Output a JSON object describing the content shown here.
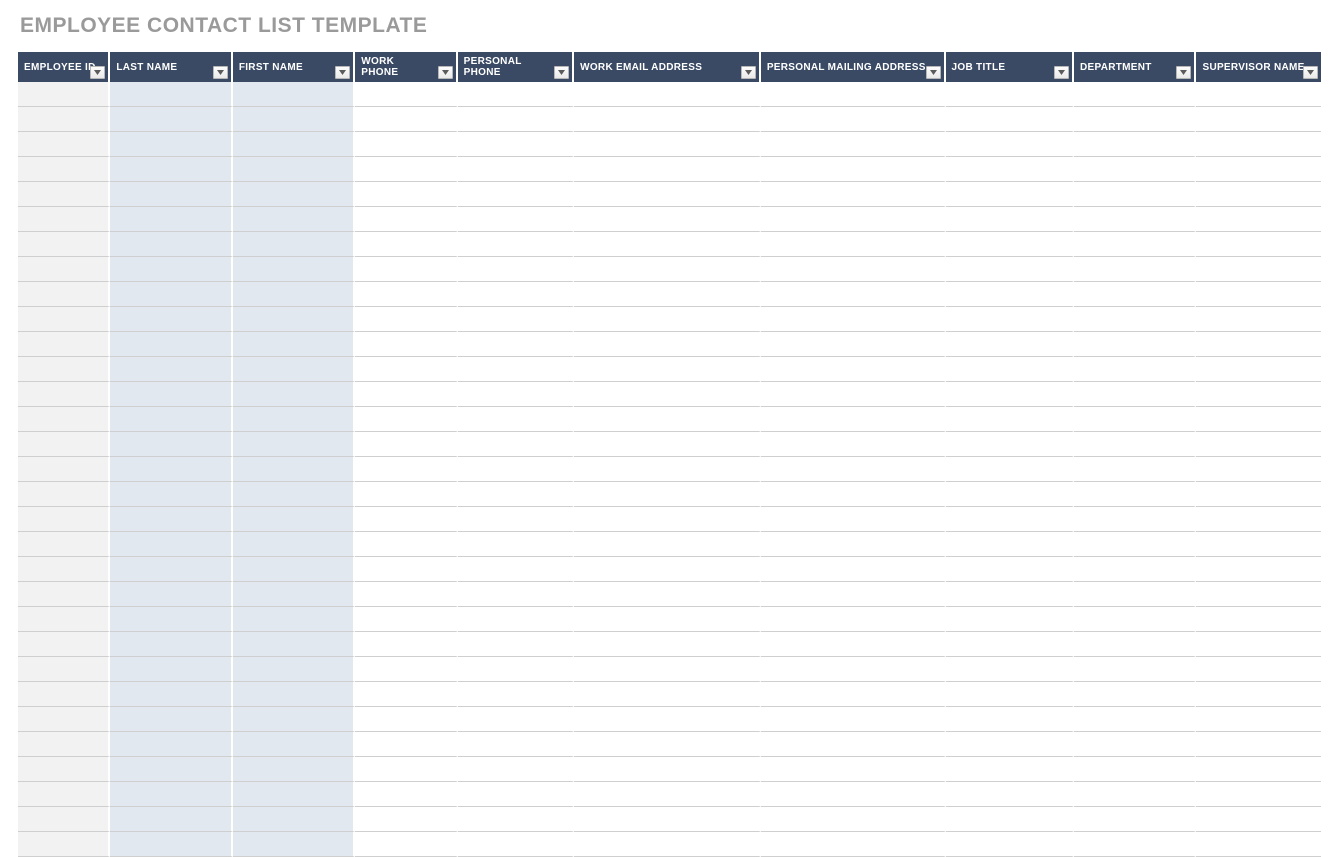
{
  "title": "EMPLOYEE CONTACT LIST TEMPLATE",
  "columns": [
    {
      "label": "EMPLOYEE ID",
      "twoLine": false
    },
    {
      "label": "LAST NAME",
      "twoLine": false
    },
    {
      "label": "FIRST NAME",
      "twoLine": false
    },
    {
      "label": "WORK PHONE",
      "twoLine": true
    },
    {
      "label": "PERSONAL PHONE",
      "twoLine": true
    },
    {
      "label": "WORK EMAIL ADDRESS",
      "twoLine": false
    },
    {
      "label": "PERSONAL MAILING ADDRESS",
      "twoLine": false
    },
    {
      "label": "JOB TITLE",
      "twoLine": false
    },
    {
      "label": "DEPARTMENT",
      "twoLine": false
    },
    {
      "label": "SUPERVISOR NAME",
      "twoLine": false
    }
  ],
  "shaded_columns": {
    "gray": [
      0
    ],
    "blue": [
      1,
      2
    ]
  },
  "row_count": 31,
  "colors": {
    "header": "#3a4a64",
    "title": "#9a9a9a",
    "gray": "#f2f2f2",
    "blue": "#e2e8f0",
    "grid": "#cfcfcf"
  }
}
